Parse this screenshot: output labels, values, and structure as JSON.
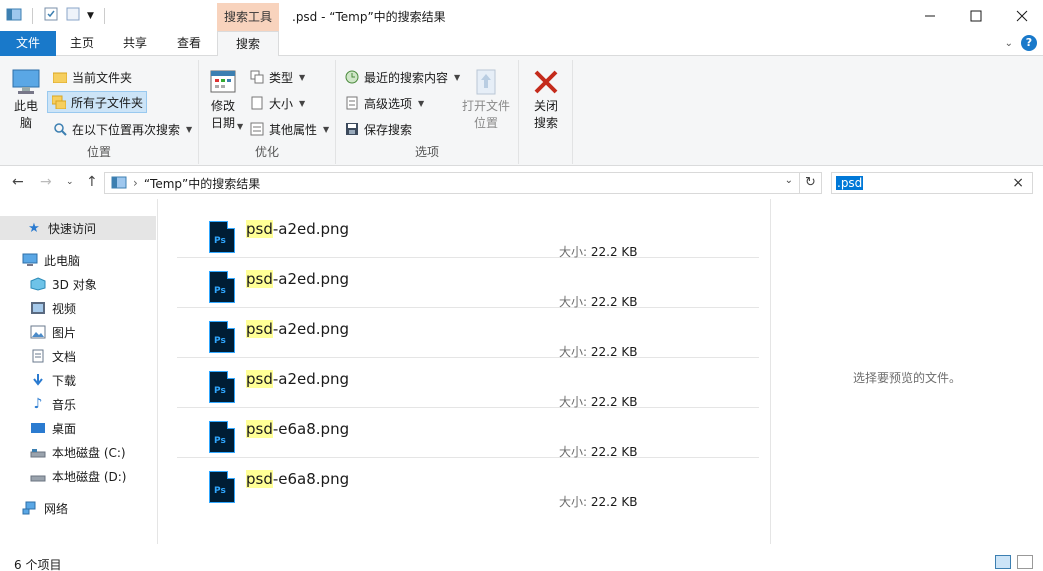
{
  "window": {
    "title": ".psd - “Temp”中的搜索结果",
    "context_tab": "搜索工具"
  },
  "tabs": [
    {
      "label": "文件"
    },
    {
      "label": "主页"
    },
    {
      "label": "共享"
    },
    {
      "label": "查看"
    },
    {
      "label": "搜索"
    }
  ],
  "ribbon": {
    "location": {
      "label": "位置",
      "this_pc": "此电脑",
      "current_folder": "当前文件夹",
      "all_subfolders": "所有子文件夹",
      "search_again_in": "在以下位置再次搜索"
    },
    "refine": {
      "label": "优化",
      "date_modified": "修改日期",
      "kind": "类型",
      "size": "大小",
      "other_properties": "其他属性"
    },
    "options": {
      "label": "选项",
      "recent_searches": "最近的搜索内容",
      "advanced_options": "高级选项",
      "save_search": "保存搜索",
      "open_file_location": "打开文件位置"
    },
    "close": {
      "close_search": "关闭搜索"
    }
  },
  "address": {
    "path": "“Temp”中的搜索结果"
  },
  "search": {
    "query": ".psd"
  },
  "nav": {
    "quick_access": "快速访问",
    "this_pc": "此电脑",
    "items": [
      {
        "label": "3D 对象"
      },
      {
        "label": "视频"
      },
      {
        "label": "图片"
      },
      {
        "label": "文档"
      },
      {
        "label": "下载"
      },
      {
        "label": "音乐"
      },
      {
        "label": "桌面"
      },
      {
        "label": "本地磁盘 (C:)"
      },
      {
        "label": "本地磁盘 (D:)"
      }
    ],
    "network": "网络"
  },
  "files": [
    {
      "match": "psd",
      "rest": "-a2ed.png",
      "size_label": "大小:",
      "size": "22.2 KB"
    },
    {
      "match": "psd",
      "rest": "-a2ed.png",
      "size_label": "大小:",
      "size": "22.2 KB"
    },
    {
      "match": "psd",
      "rest": "-a2ed.png",
      "size_label": "大小:",
      "size": "22.2 KB"
    },
    {
      "match": "psd",
      "rest": "-a2ed.png",
      "size_label": "大小:",
      "size": "22.2 KB"
    },
    {
      "match": "psd",
      "rest": "-e6a8.png",
      "size_label": "大小:",
      "size": "22.2 KB"
    },
    {
      "match": "psd",
      "rest": "-e6a8.png",
      "size_label": "大小:",
      "size": "22.2 KB"
    }
  ],
  "file_icon_text": "Ps",
  "preview": {
    "message": "选择要预览的文件。"
  },
  "status": {
    "count": "6 个项目"
  },
  "colors": {
    "accent": "#1979ca",
    "context_tab": "#f8d3bd",
    "highlight": "#ffff96",
    "ps_icon_bg": "#001d34",
    "ps_icon_fg": "#31a8ff"
  }
}
